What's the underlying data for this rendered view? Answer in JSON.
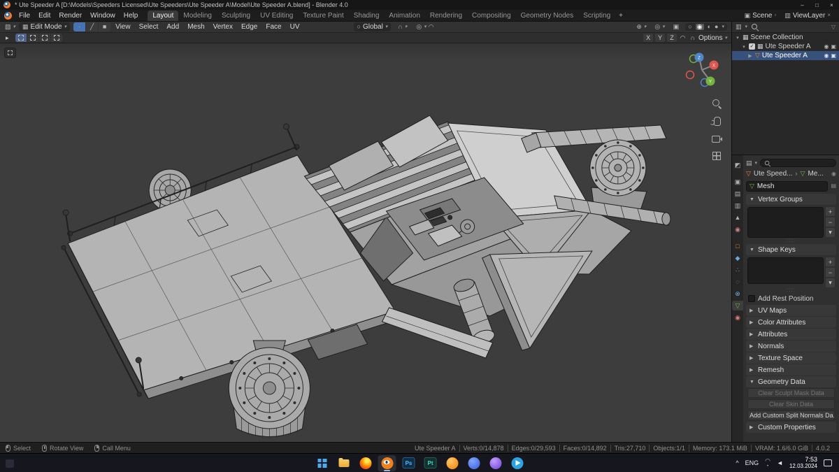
{
  "titlebar": {
    "title": "* Ute Speeder A [D:\\Models\\Speeders Licensed\\Ute Speeders\\Ute Speeder A\\Model\\Ute Speeder A.blend] - Blender 4.0"
  },
  "menubar": {
    "menus": [
      "File",
      "Edit",
      "Render",
      "Window",
      "Help"
    ],
    "workspaces": [
      "Layout",
      "Modeling",
      "Sculpting",
      "UV Editing",
      "Texture Paint",
      "Shading",
      "Animation",
      "Rendering",
      "Compositing",
      "Geometry Nodes",
      "Scripting"
    ],
    "active_workspace": "Layout",
    "new_workspace": "+",
    "scene": "Scene",
    "viewlayer": "ViewLayer"
  },
  "header": {
    "mode": "Edit Mode",
    "menus": [
      "View",
      "Select",
      "Add",
      "Mesh",
      "Vertex",
      "Edge",
      "Face",
      "UV"
    ],
    "orientation": "Global",
    "options": "Options",
    "axes": [
      "X",
      "Y",
      "Z"
    ]
  },
  "outliner": {
    "rows": [
      {
        "label": "Scene Collection"
      },
      {
        "label": "Ute Speeder A"
      },
      {
        "label": "Ute Speeder A"
      }
    ]
  },
  "properties": {
    "breadcrumb": {
      "object": "Ute Speed...",
      "data": "Me..."
    },
    "name_field": "Mesh",
    "panels": {
      "vertex_groups": "Vertex Groups",
      "shape_keys": "Shape Keys",
      "add_rest_position": "Add Rest Position",
      "uv_maps": "UV Maps",
      "color_attributes": "Color Attributes",
      "attributes": "Attributes",
      "normals": "Normals",
      "texture_space": "Texture Space",
      "remesh": "Remesh",
      "geometry_data": "Geometry Data",
      "custom_properties": "Custom Properties"
    },
    "geometry_buttons": [
      "Clear Sculpt Mask Data",
      "Clear Skin Data",
      "Add Custom Split Normals Da..."
    ],
    "tabs": [
      {
        "name": "tool",
        "glyph": "◩",
        "color": "#b0b0b0"
      },
      {
        "name": "render",
        "glyph": "▣",
        "color": "#b0b0b0"
      },
      {
        "name": "output",
        "glyph": "▤",
        "color": "#b0b0b0"
      },
      {
        "name": "view-layer",
        "glyph": "▥",
        "color": "#b0b0b0"
      },
      {
        "name": "scene",
        "glyph": "▲",
        "color": "#b0b0b0"
      },
      {
        "name": "world",
        "glyph": "◉",
        "color": "#c98484"
      },
      {
        "name": "object",
        "glyph": "□",
        "color": "#e8883a"
      },
      {
        "name": "modifiers",
        "glyph": "◆",
        "color": "#6fa8dc"
      },
      {
        "name": "particles",
        "glyph": "∴",
        "color": "#6fa8dc"
      },
      {
        "name": "physics",
        "glyph": "◌",
        "color": "#6fa8dc"
      },
      {
        "name": "constraints",
        "glyph": "⊗",
        "color": "#6fa8dc"
      },
      {
        "name": "object-data",
        "glyph": "▽",
        "color": "#6abe45"
      },
      {
        "name": "material",
        "glyph": "◉",
        "color": "#d97b7b"
      }
    ]
  },
  "statusbar": {
    "hints": [
      "Select",
      "Rotate View",
      "Call Menu"
    ],
    "stats": [
      "Ute Speeder A",
      "Verts:0/14,878",
      "Edges:0/29,593",
      "Faces:0/14,892",
      "Tris:27,710",
      "Objects:1/1",
      "Memory: 173.1 MiB",
      "VRAM: 1.6/6.0 GiB",
      "4.0.2"
    ]
  },
  "taskbar": {
    "apps": [
      {
        "name": "start"
      },
      {
        "name": "file-explorer"
      },
      {
        "name": "firefox"
      },
      {
        "name": "blender",
        "active": true
      },
      {
        "name": "photoshop",
        "label": "Ps"
      },
      {
        "name": "paint-tool",
        "label": "Pt"
      },
      {
        "name": "app-orange"
      },
      {
        "name": "app-blue"
      },
      {
        "name": "app-purple"
      },
      {
        "name": "telegram"
      }
    ],
    "tray": {
      "chevron": "^",
      "language": "ENG",
      "time": "7:53",
      "date": "12.03.2024"
    }
  },
  "colors": {
    "accent_blue": "#4772b3",
    "selection_row": "#37517c",
    "object_orange": "#e8883a",
    "data_green": "#6abe45",
    "viewport_bg": "#3d3d3d"
  },
  "icons": {
    "minimize": "–",
    "maximize": "□",
    "close": "×",
    "chevron_down": "▾",
    "chevron_right": "›",
    "panel_open": "▼",
    "panel_closed": "▶",
    "plus": "+",
    "minus": "−",
    "check": "✓",
    "grip": "::::",
    "editor_3d": "▧",
    "edit_mode": "▦",
    "vertex": "∙",
    "edge": "╱",
    "face": "■",
    "orientation": "○",
    "magnet": "∩",
    "proportional": "◎",
    "falloff": "◠",
    "gizmo": "⊕",
    "overlays": "◎",
    "xray": "▣",
    "shade_wire": "○",
    "shade_solid": "◉",
    "shade_material": "◐",
    "shade_render": "●",
    "tool_cursor": "▸",
    "outliner_editor": "▥",
    "filter": "▽",
    "collection": "▦",
    "mesh_object": "▽",
    "eye": "◉",
    "camera_render": "▣",
    "properties_editor": "▤",
    "pin": "◉",
    "mesh_data": "▽",
    "browse": "▤",
    "scene_icon": "▣",
    "new_scene": "▫",
    "viewlayer_icon": "▥",
    "remove": "×",
    "volume": "◄",
    "wifi_arc": "◠",
    "wifi_dot": "•"
  }
}
